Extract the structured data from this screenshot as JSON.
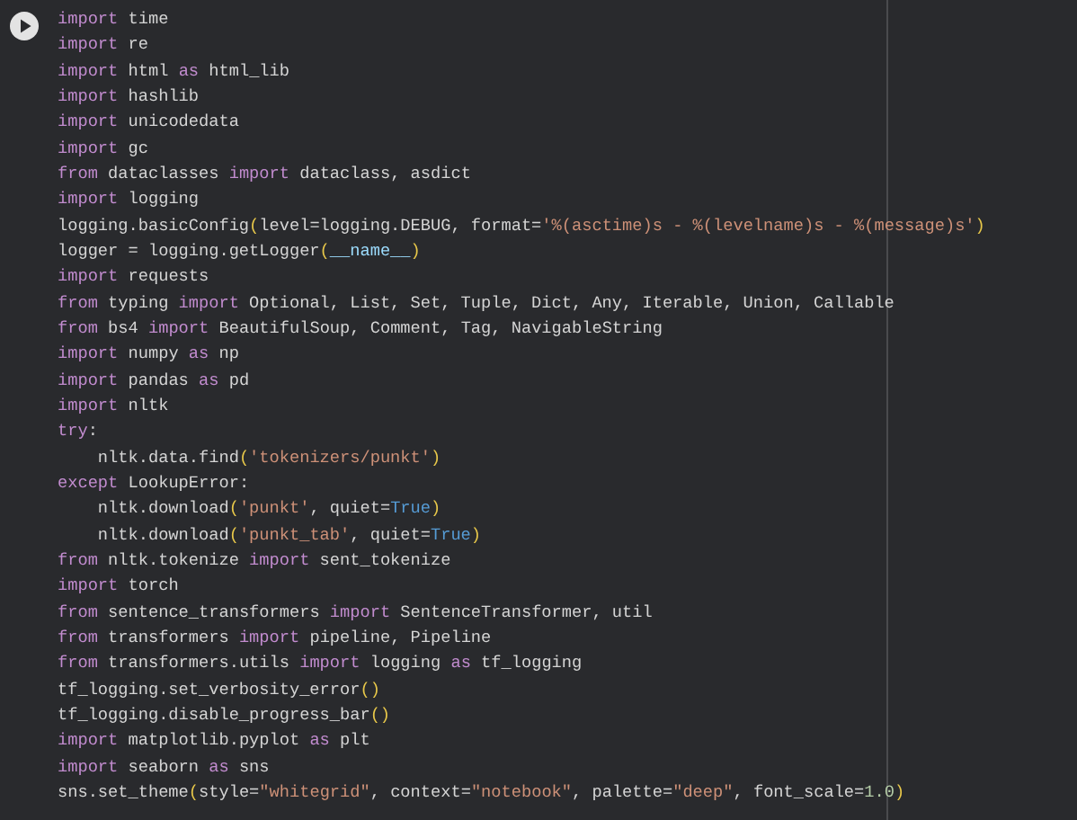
{
  "cell": {
    "run_button": {
      "kind": "play"
    },
    "lines": [
      [
        {
          "kind": "kw",
          "text": "import"
        },
        {
          "kind": "plain",
          "text": " time"
        }
      ],
      [
        {
          "kind": "kw",
          "text": "import"
        },
        {
          "kind": "plain",
          "text": " re"
        }
      ],
      [
        {
          "kind": "kw",
          "text": "import"
        },
        {
          "kind": "plain",
          "text": " html "
        },
        {
          "kind": "kw",
          "text": "as"
        },
        {
          "kind": "plain",
          "text": " html_lib"
        }
      ],
      [
        {
          "kind": "kw",
          "text": "import"
        },
        {
          "kind": "plain",
          "text": " hashlib"
        }
      ],
      [
        {
          "kind": "kw",
          "text": "import"
        },
        {
          "kind": "plain",
          "text": " unicodedata"
        }
      ],
      [
        {
          "kind": "kw",
          "text": "import"
        },
        {
          "kind": "plain",
          "text": " gc"
        }
      ],
      [
        {
          "kind": "kw",
          "text": "from"
        },
        {
          "kind": "plain",
          "text": " dataclasses "
        },
        {
          "kind": "kw",
          "text": "import"
        },
        {
          "kind": "plain",
          "text": " dataclass, asdict"
        }
      ],
      [
        {
          "kind": "kw",
          "text": "import"
        },
        {
          "kind": "plain",
          "text": " logging"
        }
      ],
      [
        {
          "kind": "plain",
          "text": "logging.basicConfig"
        },
        {
          "kind": "br",
          "text": "("
        },
        {
          "kind": "plain",
          "text": "level=logging.DEBUG, format="
        },
        {
          "kind": "str",
          "text": "'%(asctime)s - %(levelname)s - %(message)s'"
        },
        {
          "kind": "br",
          "text": ")"
        }
      ],
      [
        {
          "kind": "plain",
          "text": "logger = logging.getLogger"
        },
        {
          "kind": "br",
          "text": "("
        },
        {
          "kind": "name",
          "text": "__name__"
        },
        {
          "kind": "br",
          "text": ")"
        }
      ],
      [
        {
          "kind": "kw",
          "text": "import"
        },
        {
          "kind": "plain",
          "text": " requests"
        }
      ],
      [
        {
          "kind": "kw",
          "text": "from"
        },
        {
          "kind": "plain",
          "text": " typing "
        },
        {
          "kind": "kw",
          "text": "import"
        },
        {
          "kind": "plain",
          "text": " Optional, List, Set, Tuple, Dict, Any, Iterable, Union, Callable"
        }
      ],
      [
        {
          "kind": "kw",
          "text": "from"
        },
        {
          "kind": "plain",
          "text": " bs4 "
        },
        {
          "kind": "kw",
          "text": "import"
        },
        {
          "kind": "plain",
          "text": " BeautifulSoup, Comment, Tag, NavigableString"
        }
      ],
      [
        {
          "kind": "kw",
          "text": "import"
        },
        {
          "kind": "plain",
          "text": " numpy "
        },
        {
          "kind": "kw",
          "text": "as"
        },
        {
          "kind": "plain",
          "text": " np"
        }
      ],
      [
        {
          "kind": "kw",
          "text": "import"
        },
        {
          "kind": "plain",
          "text": " pandas "
        },
        {
          "kind": "kw",
          "text": "as"
        },
        {
          "kind": "plain",
          "text": " pd"
        }
      ],
      [
        {
          "kind": "kw",
          "text": "import"
        },
        {
          "kind": "plain",
          "text": " nltk"
        }
      ],
      [
        {
          "kind": "kw",
          "text": "try"
        },
        {
          "kind": "plain",
          "text": ":"
        }
      ],
      [
        {
          "kind": "plain",
          "text": "    nltk.data.find"
        },
        {
          "kind": "br",
          "text": "("
        },
        {
          "kind": "str",
          "text": "'tokenizers/punkt'"
        },
        {
          "kind": "br",
          "text": ")"
        }
      ],
      [
        {
          "kind": "kw",
          "text": "except"
        },
        {
          "kind": "plain",
          "text": " LookupError:"
        }
      ],
      [
        {
          "kind": "plain",
          "text": "    nltk.download"
        },
        {
          "kind": "br",
          "text": "("
        },
        {
          "kind": "str",
          "text": "'punkt'"
        },
        {
          "kind": "plain",
          "text": ", quiet="
        },
        {
          "kind": "const",
          "text": "True"
        },
        {
          "kind": "br",
          "text": ")"
        }
      ],
      [
        {
          "kind": "plain",
          "text": "    nltk.download"
        },
        {
          "kind": "br",
          "text": "("
        },
        {
          "kind": "str",
          "text": "'punkt_tab'"
        },
        {
          "kind": "plain",
          "text": ", quiet="
        },
        {
          "kind": "const",
          "text": "True"
        },
        {
          "kind": "br",
          "text": ")"
        }
      ],
      [
        {
          "kind": "kw",
          "text": "from"
        },
        {
          "kind": "plain",
          "text": " nltk.tokenize "
        },
        {
          "kind": "kw",
          "text": "import"
        },
        {
          "kind": "plain",
          "text": " sent_tokenize"
        }
      ],
      [
        {
          "kind": "kw",
          "text": "import"
        },
        {
          "kind": "plain",
          "text": " torch"
        }
      ],
      [
        {
          "kind": "kw",
          "text": "from"
        },
        {
          "kind": "plain",
          "text": " sentence_transformers "
        },
        {
          "kind": "kw",
          "text": "import"
        },
        {
          "kind": "plain",
          "text": " SentenceTransformer, util"
        }
      ],
      [
        {
          "kind": "kw",
          "text": "from"
        },
        {
          "kind": "plain",
          "text": " transformers "
        },
        {
          "kind": "kw",
          "text": "import"
        },
        {
          "kind": "plain",
          "text": " pipeline, Pipeline"
        }
      ],
      [
        {
          "kind": "kw",
          "text": "from"
        },
        {
          "kind": "plain",
          "text": " transformers.utils "
        },
        {
          "kind": "kw",
          "text": "import"
        },
        {
          "kind": "plain",
          "text": " logging "
        },
        {
          "kind": "kw",
          "text": "as"
        },
        {
          "kind": "plain",
          "text": " tf_logging"
        }
      ],
      [
        {
          "kind": "plain",
          "text": "tf_logging.set_verbosity_error"
        },
        {
          "kind": "br",
          "text": "()"
        }
      ],
      [
        {
          "kind": "plain",
          "text": "tf_logging.disable_progress_bar"
        },
        {
          "kind": "br",
          "text": "()"
        }
      ],
      [
        {
          "kind": "kw",
          "text": "import"
        },
        {
          "kind": "plain",
          "text": " matplotlib.pyplot "
        },
        {
          "kind": "kw",
          "text": "as"
        },
        {
          "kind": "plain",
          "text": " plt"
        }
      ],
      [
        {
          "kind": "kw",
          "text": "import"
        },
        {
          "kind": "plain",
          "text": " seaborn "
        },
        {
          "kind": "kw",
          "text": "as"
        },
        {
          "kind": "plain",
          "text": " sns"
        }
      ],
      [
        {
          "kind": "plain",
          "text": "sns.set_theme"
        },
        {
          "kind": "br",
          "text": "("
        },
        {
          "kind": "plain",
          "text": "style="
        },
        {
          "kind": "str",
          "text": "\"whitegrid\""
        },
        {
          "kind": "plain",
          "text": ", context="
        },
        {
          "kind": "str",
          "text": "\"notebook\""
        },
        {
          "kind": "plain",
          "text": ", palette="
        },
        {
          "kind": "str",
          "text": "\"deep\""
        },
        {
          "kind": "plain",
          "text": ", font_scale="
        },
        {
          "kind": "num",
          "text": "1.0"
        },
        {
          "kind": "br",
          "text": ")"
        }
      ]
    ]
  }
}
